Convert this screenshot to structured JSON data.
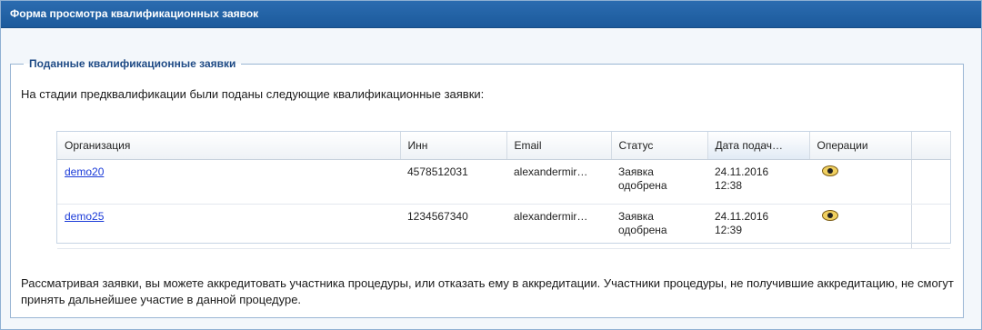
{
  "panel": {
    "title": "Форма просмотра квалификационных заявок"
  },
  "group": {
    "legend": "Поданные квалификационные заявки",
    "intro": "На стадии предквалификации были поданы следующие квалификационные заявки:",
    "note": "Рассматривая заявки, вы можете аккредитовать участника процедуры, или отказать ему в аккредитации. Участники процедуры, не получившие аккредитацию, не смогут принять дальнейшее участие в данной процедуре."
  },
  "table": {
    "columns": {
      "org": "Организация",
      "inn": "Инн",
      "email": "Email",
      "status": "Статус",
      "date": "Дата подач…",
      "ops": "Операции"
    },
    "rows": [
      {
        "org": "demo20",
        "inn": "4578512031",
        "email": "alexandermir…",
        "status_line1": "Заявка",
        "status_line2": "одобрена",
        "date_line1": "24.11.2016",
        "date_line2": "12:38",
        "op_icon": "eye-icon"
      },
      {
        "org": "demo25",
        "inn": "1234567340",
        "email": "alexandermir…",
        "status_line1": "Заявка",
        "status_line2": "одобрена",
        "date_line1": "24.11.2016",
        "date_line2": "12:39",
        "op_icon": "eye-icon"
      }
    ]
  },
  "colors": {
    "header_bg": "#1c5a9c",
    "legend_text": "#1e4a85",
    "link": "#1a3ad8"
  }
}
